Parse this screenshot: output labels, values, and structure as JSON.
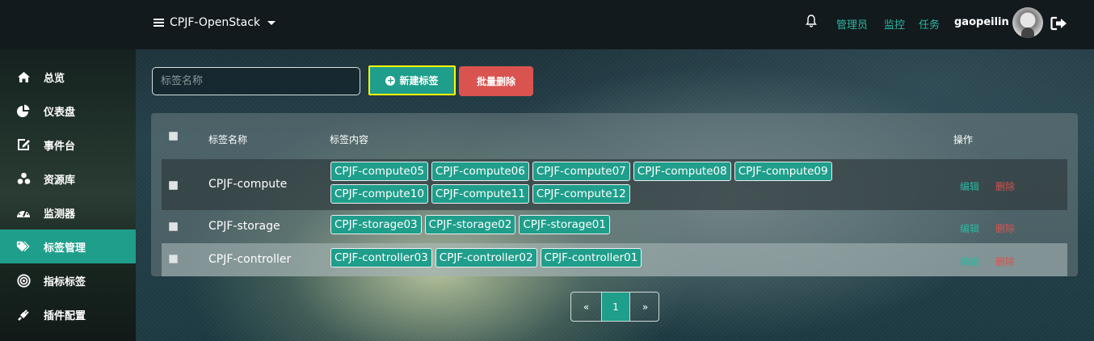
{
  "header": {
    "project_name": "CPJF-OpenStack",
    "links": [
      "管理员",
      "监控",
      "任务"
    ],
    "username": "gaopeilin",
    "accent_color": "#2db6a1"
  },
  "sidebar": {
    "items": [
      {
        "label": "总览",
        "icon": "home-icon"
      },
      {
        "label": "仪表盘",
        "icon": "pie-chart-icon"
      },
      {
        "label": "事件台",
        "icon": "edit-icon"
      },
      {
        "label": "资源库",
        "icon": "cubes-icon"
      },
      {
        "label": "监测器",
        "icon": "dashboard-icon"
      },
      {
        "label": "标签管理",
        "icon": "tags-icon",
        "active": true
      },
      {
        "label": "指标标签",
        "icon": "bullseye-icon"
      },
      {
        "label": "插件配置",
        "icon": "plug-icon"
      }
    ]
  },
  "toolbar": {
    "search_placeholder": "标签名称",
    "new_label": "新建标签",
    "batch_delete_label": "批量删除"
  },
  "table": {
    "headers": {
      "name": "标签名称",
      "content": "标签内容",
      "actions": "操作"
    },
    "edit_label": "编辑",
    "delete_label": "删除",
    "rows": [
      {
        "name": "CPJF-compute",
        "tags": [
          "CPJF-compute05",
          "CPJF-compute06",
          "CPJF-compute07",
          "CPJF-compute08",
          "CPJF-compute09",
          "CPJF-compute10",
          "CPJF-compute11",
          "CPJF-compute12"
        ]
      },
      {
        "name": "CPJF-storage",
        "tags": [
          "CPJF-storage03",
          "CPJF-storage02",
          "CPJF-storage01"
        ]
      },
      {
        "name": "CPJF-controller",
        "tags": [
          "CPJF-controller03",
          "CPJF-controller02",
          "CPJF-controller01"
        ]
      }
    ]
  },
  "pagination": {
    "prev": "«",
    "current": "1",
    "next": "»"
  }
}
